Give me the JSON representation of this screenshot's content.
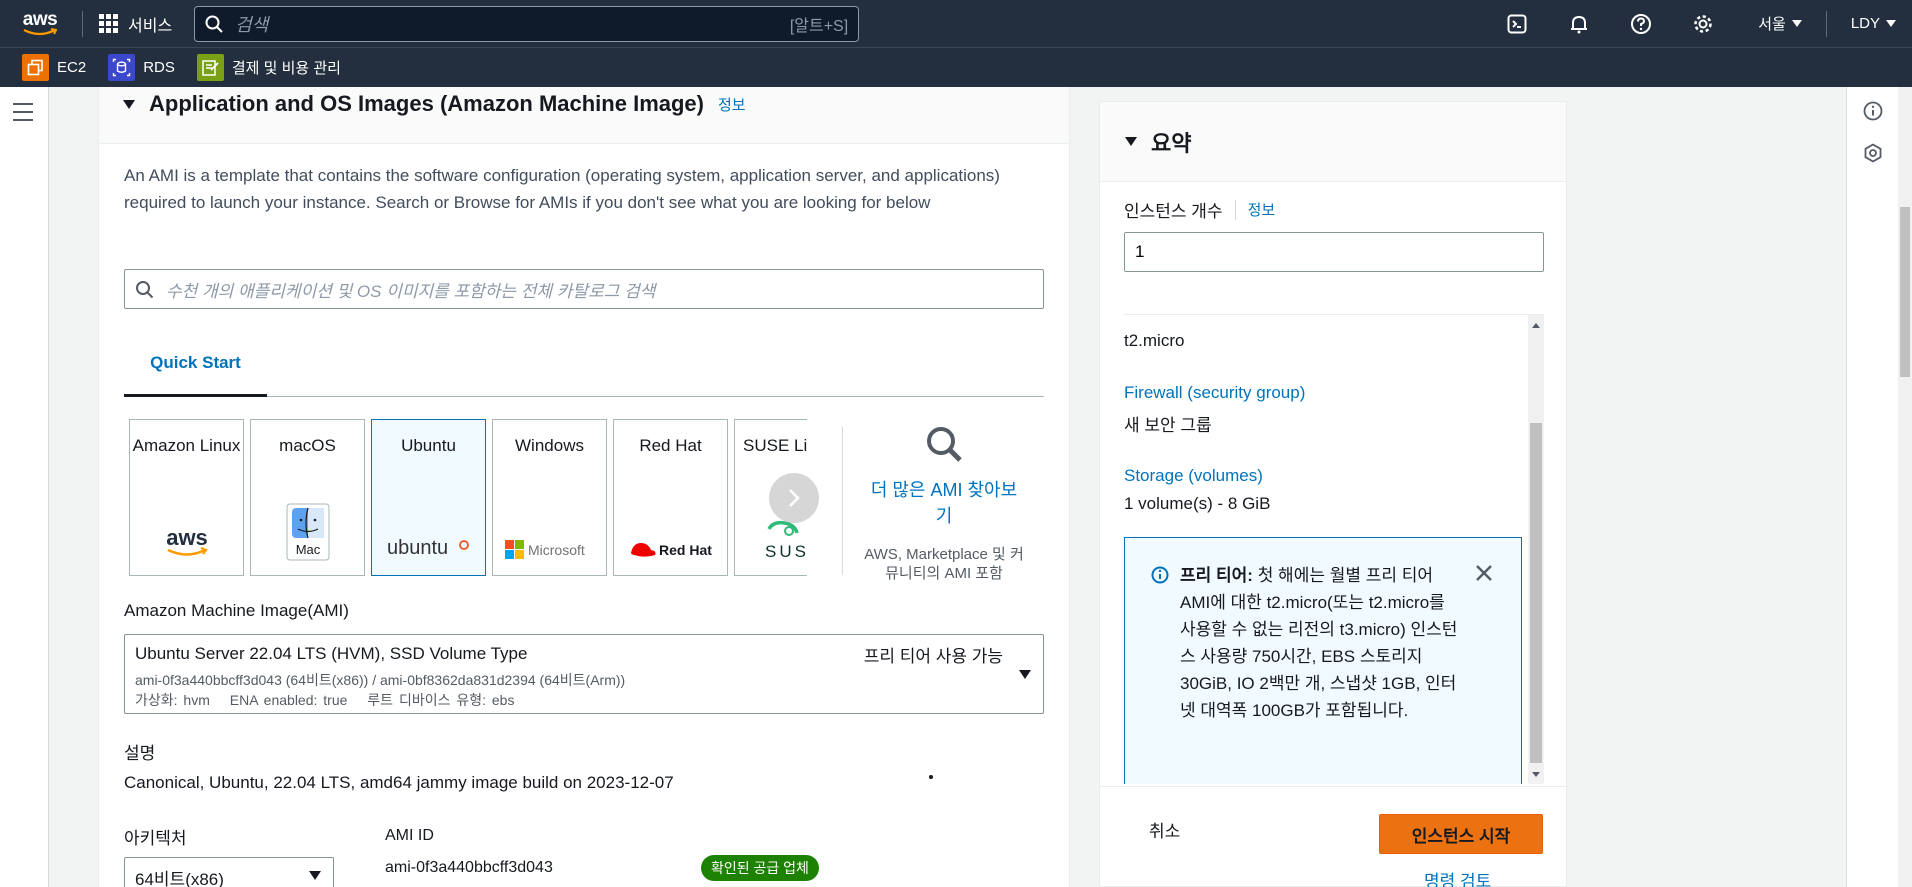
{
  "topnav": {
    "logo_text": "aws",
    "services_label": "서비스",
    "search_placeholder": "검색",
    "search_shortcut": "[알트+S]",
    "region_label": "서울",
    "user_label": "LDY"
  },
  "favorites": [
    {
      "label": "EC2",
      "color": "#ed7100"
    },
    {
      "label": "RDS",
      "color": "#3b48cc"
    },
    {
      "label": "결제 및 비용 관리",
      "color": "#7aa116"
    }
  ],
  "ami_section": {
    "title": "Application and OS Images (Amazon Machine Image)",
    "info_link": "정보",
    "description": "An AMI is a template that contains the software configuration (operating system, application server, and applications) required to launch your instance. Search or Browse for AMIs if you don't see what you are looking for below",
    "search_placeholder": "수천 개의 애플리케이션 및 OS 이미지를 포함하는 전체 카탈로그 검색",
    "tab_label": "Quick Start",
    "cards": [
      {
        "name": "Amazon Linux",
        "logo": "aws",
        "selected": false
      },
      {
        "name": "macOS",
        "logo": "Mac",
        "selected": false
      },
      {
        "name": "Ubuntu",
        "logo": "ubuntu",
        "selected": true
      },
      {
        "name": "Windows",
        "logo": "Microsoft",
        "selected": false
      },
      {
        "name": "Red Hat",
        "logo": "Red Hat",
        "selected": false
      },
      {
        "name": "SUSE Li",
        "logo": "SUSE",
        "selected": false
      }
    ],
    "more_ami_link": "더 많은 AMI 찾아보기",
    "more_ami_sub": "AWS, Marketplace 및 커뮤니티의 AMI 포함",
    "ami_label": "Amazon Machine Image(AMI)",
    "ami_selected": {
      "name": "Ubuntu Server 22.04 LTS (HVM), SSD Volume Type",
      "ids": "ami-0f3a440bbcff3d043 (64비트(x86)) / ami-0bf8362da831d2394 (64비트(Arm))",
      "virt": "가상화: hvm",
      "ena": "ENA enabled: true",
      "root": "루트 디바이스 유형: ebs",
      "free_tier": "프리 티어 사용 가능"
    },
    "desc_label": "설명",
    "desc_value": "Canonical, Ubuntu, 22.04 LTS, amd64 jammy image build on 2023-12-07",
    "arch_label": "아키텍처",
    "arch_value": "64비트(x86)",
    "ami_id_label": "AMI ID",
    "ami_id_value": "ami-0f3a440bbcff3d043",
    "verified_badge": "확인된 공급 업체"
  },
  "summary": {
    "title": "요약",
    "instance_count_label": "인스턴스 개수",
    "instance_count_info": "정보",
    "instance_count_value": "1",
    "instance_type": "t2.micro",
    "firewall_link": "Firewall (security group)",
    "firewall_value": "새 보안 그룹",
    "storage_link": "Storage (volumes)",
    "storage_value": "1 volume(s) - 8 GiB",
    "free_tier_title": "프리 티어:",
    "free_tier_text": "첫 해에는 월별 프리 티어 AMI에 대한 t2.micro(또는 t2.micro를 사용할 수 없는 리전의 t3.micro) 인스턴스 사용량 750시간, EBS 스토리지 30GiB, IO 2백만 개, 스냅샷 1GB, 인터넷 대역폭 100GB가 포함됩니다.",
    "cancel_label": "취소",
    "launch_label": "인스턴스 시작",
    "review_label": "명령 검토"
  }
}
